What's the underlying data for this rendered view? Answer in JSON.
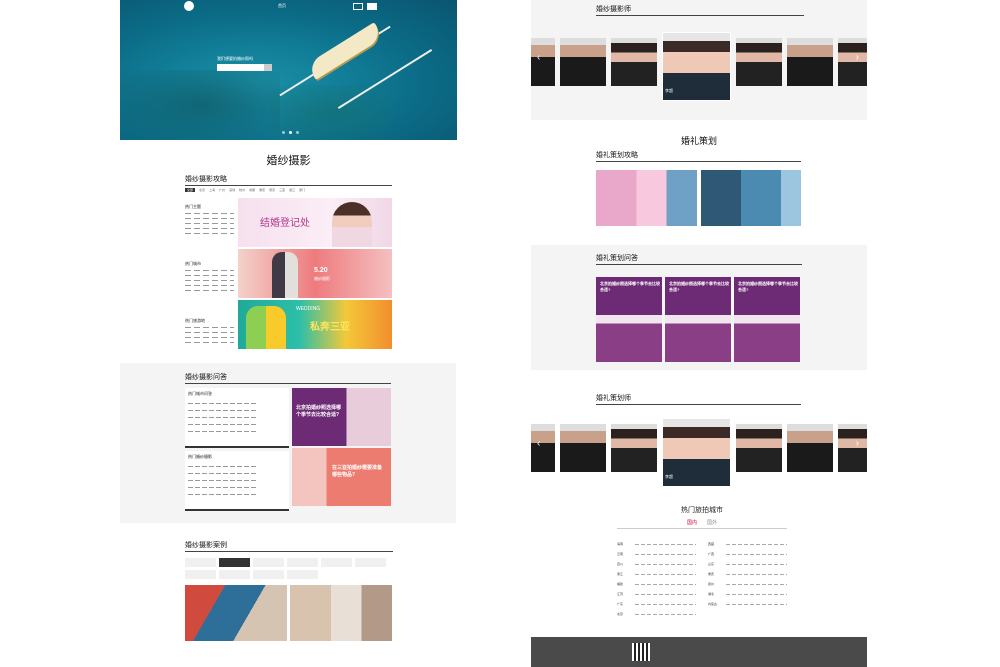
{
  "hero": {
    "logo_text": "",
    "nav": [
      "首页",
      "",
      ""
    ],
    "buttons": [
      "",
      ""
    ],
    "search_question": "我们想要拍婚纱照吗",
    "dots": 3
  },
  "wedding_photo": {
    "title": "婚纱摄影",
    "guide": {
      "title": "婚纱摄影攻略",
      "tags": [
        "全部",
        "北京",
        "上海",
        "广州",
        "深圳",
        "杭州",
        "成都",
        "重庆",
        "南京",
        "三亚",
        "丽江",
        "厦门"
      ],
      "blocks": [
        "热门主题",
        "热门城市",
        "热门旅游地"
      ]
    },
    "banners": {
      "b1_text": "结婚登记处",
      "b2_text": "5.20",
      "b2_sub": "婚纱摄影",
      "b3_top": "WEDDING",
      "b3_text": "私奔三亚"
    },
    "qa": {
      "title": "婚纱摄影问答",
      "blocks": [
        "热门城市问答",
        "热门婚纱摄影"
      ],
      "pic1_text": "北京拍婚纱照选择哪个季节去比较合适?",
      "pic2_text": "在三亚拍婚纱需要准备哪些物品?"
    },
    "cases": {
      "title": "婚纱摄影案例"
    }
  },
  "right": {
    "photographers": {
      "title": "婚纱摄影师",
      "featured_name": "李超"
    },
    "wedding_planning": "婚礼策划",
    "planning_guide": "婚礼策划攻略",
    "planning_qa": "婚礼策划问答",
    "planning_qa_card_text": "北京拍婚纱照选择哪个季节去比较合适?",
    "planners": {
      "title": "婚礼策划师",
      "featured_name": "李超"
    },
    "cities": {
      "title": "热门旅拍城市",
      "tabs": [
        "国内",
        "国外"
      ],
      "left_cities": [
        "海南",
        "云南",
        "四川",
        "浙江",
        "福建",
        "江苏",
        "广东",
        "北京"
      ],
      "right_cities": [
        "西藏",
        "广西",
        "山东",
        "重庆",
        "贵州",
        "湖北",
        "内蒙古"
      ]
    }
  }
}
